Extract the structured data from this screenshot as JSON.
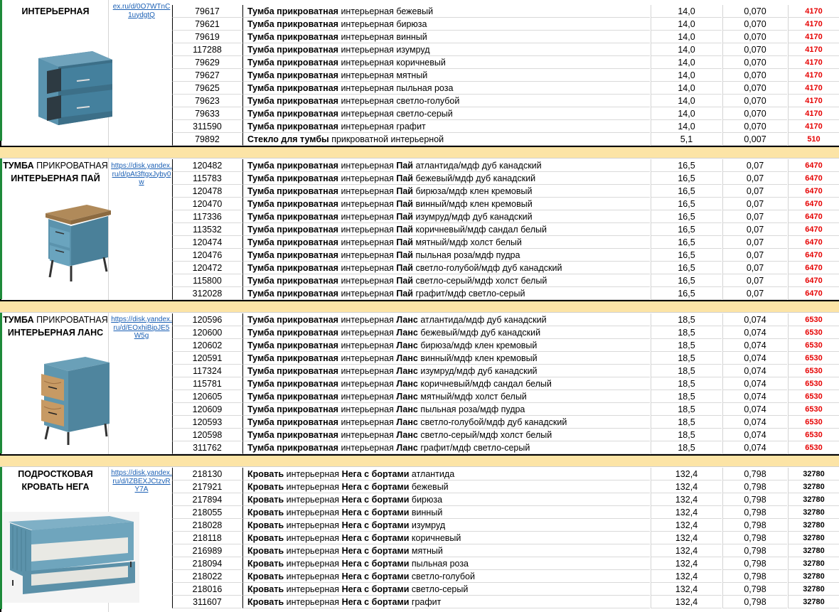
{
  "colors": {
    "price_red": "#e60000",
    "separator_band": "#fce4a6",
    "link": "#1a5fb4"
  },
  "sections": [
    {
      "title_bold": "ИНТЕРЬЕРНАЯ",
      "title_rest": "",
      "link": "ex.ru/d/0O7WTnC1uydgtQ",
      "image": "blue-nightstand-two-drawers",
      "price_color": "red",
      "rows": [
        {
          "code": "79617",
          "b1": "Тумба прикроватная",
          "t1": " интерьерная бежевый",
          "b2": "",
          "t2": "",
          "vol": "14,0",
          "w": "0,070",
          "price": "4170"
        },
        {
          "code": "79621",
          "b1": "Тумба прикроватная",
          "t1": " интерьерная бирюза",
          "b2": "",
          "t2": "",
          "vol": "14,0",
          "w": "0,070",
          "price": "4170"
        },
        {
          "code": "79619",
          "b1": "Тумба прикроватная",
          "t1": " интерьерная винный",
          "b2": "",
          "t2": "",
          "vol": "14,0",
          "w": "0,070",
          "price": "4170"
        },
        {
          "code": "117288",
          "b1": "Тумба прикроватная",
          "t1": " интерьерная изумруд",
          "b2": "",
          "t2": "",
          "vol": "14,0",
          "w": "0,070",
          "price": "4170"
        },
        {
          "code": "79629",
          "b1": "Тумба прикроватная",
          "t1": " интерьерная коричневый",
          "b2": "",
          "t2": "",
          "vol": "14,0",
          "w": "0,070",
          "price": "4170"
        },
        {
          "code": "79627",
          "b1": "Тумба прикроватная",
          "t1": " интерьерная мятный",
          "b2": "",
          "t2": "",
          "vol": "14,0",
          "w": "0,070",
          "price": "4170"
        },
        {
          "code": "79625",
          "b1": "Тумба прикроватная",
          "t1": " интерьерная пыльная роза",
          "b2": "",
          "t2": "",
          "vol": "14,0",
          "w": "0,070",
          "price": "4170"
        },
        {
          "code": "79623",
          "b1": "Тумба прикроватная",
          "t1": " интерьерная светло-голубой",
          "b2": "",
          "t2": "",
          "vol": "14,0",
          "w": "0,070",
          "price": "4170"
        },
        {
          "code": "79633",
          "b1": "Тумба прикроватная",
          "t1": " интерьерная светло-серый",
          "b2": "",
          "t2": "",
          "vol": "14,0",
          "w": "0,070",
          "price": "4170"
        },
        {
          "code": "311590",
          "b1": "Тумба прикроватная",
          "t1": " интерьерная графит",
          "b2": "",
          "t2": "",
          "vol": "14,0",
          "w": "0,070",
          "price": "4170"
        },
        {
          "code": "79892",
          "b1": "Стекло для тумбы",
          "t1": " прикроватной интерьерной",
          "b2": "",
          "t2": "",
          "vol": "5,1",
          "w": "0,007",
          "price": "510"
        }
      ]
    },
    {
      "title_bold": "ТУМБА",
      "title_rest": " ПРИКРОВАТНАЯ",
      "title_line2": "ИНТЕРЬЕРНАЯ ПАЙ",
      "link": "https://disk.yandex.ru/d/pAt3ftgxJyby0w",
      "image": "nightstand-pai-wood-top",
      "price_color": "red",
      "rows": [
        {
          "code": "120482",
          "b1": "Тумба прикроватная",
          "t1": " интерьерная ",
          "b2": "Пай",
          "t2": " атлантида/мдф дуб канадский",
          "vol": "16,5",
          "w": "0,07",
          "price": "6470"
        },
        {
          "code": "115783",
          "b1": "Тумба прикроватная",
          "t1": " интерьерная ",
          "b2": "Пай",
          "t2": " бежевый/мдф дуб канадский",
          "vol": "16,5",
          "w": "0,07",
          "price": "6470"
        },
        {
          "code": "120478",
          "b1": "Тумба прикроватная",
          "t1": " интерьерная ",
          "b2": "Пай",
          "t2": " бирюза/мдф клен кремовый",
          "vol": "16,5",
          "w": "0,07",
          "price": "6470"
        },
        {
          "code": "120470",
          "b1": "Тумба прикроватная",
          "t1": " интерьерная ",
          "b2": "Пай",
          "t2": " винный/мдф клен кремовый",
          "vol": "16,5",
          "w": "0,07",
          "price": "6470"
        },
        {
          "code": "117336",
          "b1": "Тумба прикроватная",
          "t1": " интерьерная ",
          "b2": "Пай",
          "t2": " изумруд/мдф дуб канадский",
          "vol": "16,5",
          "w": "0,07",
          "price": "6470"
        },
        {
          "code": "113532",
          "b1": "Тумба прикроватная",
          "t1": " интерьерная ",
          "b2": "Пай",
          "t2": " коричневый/мдф сандал белый",
          "vol": "16,5",
          "w": "0,07",
          "price": "6470"
        },
        {
          "code": "120474",
          "b1": "Тумба прикроватная",
          "t1": " интерьерная ",
          "b2": "Пай",
          "t2": " мятный/мдф холст белый",
          "vol": "16,5",
          "w": "0,07",
          "price": "6470"
        },
        {
          "code": "120476",
          "b1": "Тумба прикроватная",
          "t1": " интерьерная ",
          "b2": "Пай",
          "t2": " пыльная роза/мдф пудра",
          "vol": "16,5",
          "w": "0,07",
          "price": "6470"
        },
        {
          "code": "120472",
          "b1": "Тумба прикроватная",
          "t1": " интерьерная ",
          "b2": "Пай",
          "t2": " светло-голубой/мдф дуб канадский",
          "vol": "16,5",
          "w": "0,07",
          "price": "6470"
        },
        {
          "code": "115800",
          "b1": "Тумба прикроватная",
          "t1": " интерьерная ",
          "b2": "Пай",
          "t2": " светло-серый/мдф холст белый",
          "vol": "16,5",
          "w": "0,07",
          "price": "6470"
        },
        {
          "code": "312028",
          "b1": "Тумба прикроватная",
          "t1": " интерьерная ",
          "b2": "Пай",
          "t2": " графит/мдф светло-серый",
          "vol": "16,5",
          "w": "0,07",
          "price": "6470"
        }
      ]
    },
    {
      "title_bold": "ТУМБА",
      "title_rest": " ПРИКРОВАТНАЯ",
      "title_line2": "ИНТЕРЬЕРНАЯ ЛАНС",
      "link": "https://disk.yandex.ru/d/EOxhiBipJE5W5g",
      "image": "nightstand-lans-wood-drawers",
      "price_color": "red",
      "rows": [
        {
          "code": "120596",
          "b1": "Тумба прикроватная",
          "t1": " интерьерная ",
          "b2": "Ланс",
          "t2": " атлантида/мдф дуб канадский",
          "vol": "18,5",
          "w": "0,074",
          "price": "6530"
        },
        {
          "code": "120600",
          "b1": "Тумба прикроватная",
          "t1": " интерьерная ",
          "b2": "Ланс",
          "t2": " бежевый/мдф дуб канадский",
          "vol": "18,5",
          "w": "0,074",
          "price": "6530"
        },
        {
          "code": "120602",
          "b1": "Тумба прикроватная",
          "t1": " интерьерная ",
          "b2": "Ланс",
          "t2": " бирюза/мдф клен кремовый",
          "vol": "18,5",
          "w": "0,074",
          "price": "6530"
        },
        {
          "code": "120591",
          "b1": "Тумба прикроватная",
          "t1": " интерьерная ",
          "b2": "Ланс",
          "t2": " винный/мдф клен кремовый",
          "vol": "18,5",
          "w": "0,074",
          "price": "6530"
        },
        {
          "code": "117324",
          "b1": "Тумба прикроватная",
          "t1": " интерьерная ",
          "b2": "Ланс",
          "t2": " изумруд/мдф дуб канадский",
          "vol": "18,5",
          "w": "0,074",
          "price": "6530"
        },
        {
          "code": "115781",
          "b1": "Тумба прикроватная",
          "t1": " интерьерная ",
          "b2": "Ланс",
          "t2": " коричневый/мдф сандал белый",
          "vol": "18,5",
          "w": "0,074",
          "price": "6530"
        },
        {
          "code": "120605",
          "b1": "Тумба прикроватная",
          "t1": " интерьерная ",
          "b2": "Ланс",
          "t2": " мятный/мдф холст белый",
          "vol": "18,5",
          "w": "0,074",
          "price": "6530"
        },
        {
          "code": "120609",
          "b1": "Тумба прикроватная",
          "t1": " интерьерная ",
          "b2": "Ланс",
          "t2": " пыльная роза/мдф пудра",
          "vol": "18,5",
          "w": "0,074",
          "price": "6530"
        },
        {
          "code": "120593",
          "b1": "Тумба прикроватная",
          "t1": " интерьерная ",
          "b2": "Ланс",
          "t2": " светло-голубой/мдф дуб канадский",
          "vol": "18,5",
          "w": "0,074",
          "price": "6530"
        },
        {
          "code": "120598",
          "b1": "Тумба прикроватная",
          "t1": " интерьерная ",
          "b2": "Ланс",
          "t2": " светло-серый/мдф холст белый",
          "vol": "18,5",
          "w": "0,074",
          "price": "6530"
        },
        {
          "code": "311762",
          "b1": "Тумба прикроватная",
          "t1": " интерьерная ",
          "b2": "Ланс",
          "t2": " графит/мдф светло-серый",
          "vol": "18,5",
          "w": "0,074",
          "price": "6530"
        }
      ]
    },
    {
      "title_bold": "ПОДРОСТКОВАЯ",
      "title_rest": "",
      "title_line2": "КРОВАТЬ НЕГА",
      "link": "https://disk.yandex.ru/d/IZBEXJCtzvRY7A",
      "image": "teen-bed-nega-with-trundle",
      "price_color": "black",
      "rows": [
        {
          "code": "218130",
          "b1": "Кровать",
          "t1": " интерьерная ",
          "b2": "Нега с бортами",
          "t2": " атлантида",
          "vol": "132,4",
          "w": "0,798",
          "price": "32780"
        },
        {
          "code": "217921",
          "b1": "Кровать",
          "t1": " интерьерная ",
          "b2": "Нега с бортами",
          "t2": " бежевый",
          "vol": "132,4",
          "w": "0,798",
          "price": "32780"
        },
        {
          "code": "217894",
          "b1": "Кровать",
          "t1": " интерьерная ",
          "b2": "Нега с бортами",
          "t2": " бирюза",
          "vol": "132,4",
          "w": "0,798",
          "price": "32780"
        },
        {
          "code": "218055",
          "b1": "Кровать",
          "t1": " интерьерная ",
          "b2": "Нега с бортами",
          "t2": " винный",
          "vol": "132,4",
          "w": "0,798",
          "price": "32780"
        },
        {
          "code": "218028",
          "b1": "Кровать",
          "t1": " интерьерная ",
          "b2": "Нега с бортами",
          "t2": " изумруд",
          "vol": "132,4",
          "w": "0,798",
          "price": "32780"
        },
        {
          "code": "218118",
          "b1": "Кровать",
          "t1": " интерьерная ",
          "b2": "Нега с бортами",
          "t2": " коричневый",
          "vol": "132,4",
          "w": "0,798",
          "price": "32780"
        },
        {
          "code": "216989",
          "b1": "Кровать",
          "t1": " интерьерная ",
          "b2": "Нега с бортами",
          "t2": " мятный",
          "vol": "132,4",
          "w": "0,798",
          "price": "32780"
        },
        {
          "code": "218094",
          "b1": "Кровать",
          "t1": " интерьерная ",
          "b2": "Нега с бортами",
          "t2": " пыльная роза",
          "vol": "132,4",
          "w": "0,798",
          "price": "32780"
        },
        {
          "code": "218022",
          "b1": "Кровать",
          "t1": " интерьерная ",
          "b2": "Нега с бортами",
          "t2": " светло-голубой",
          "vol": "132,4",
          "w": "0,798",
          "price": "32780"
        },
        {
          "code": "218016",
          "b1": "Кровать",
          "t1": " интерьерная ",
          "b2": "Нега с бортами",
          "t2": " светло-серый",
          "vol": "132,4",
          "w": "0,798",
          "price": "32780"
        },
        {
          "code": "311607",
          "b1": "Кровать",
          "t1": " интерьерная ",
          "b2": "Нега с бортами",
          "t2": " графит",
          "vol": "132,4",
          "w": "0,798",
          "price": "32780"
        }
      ]
    }
  ]
}
